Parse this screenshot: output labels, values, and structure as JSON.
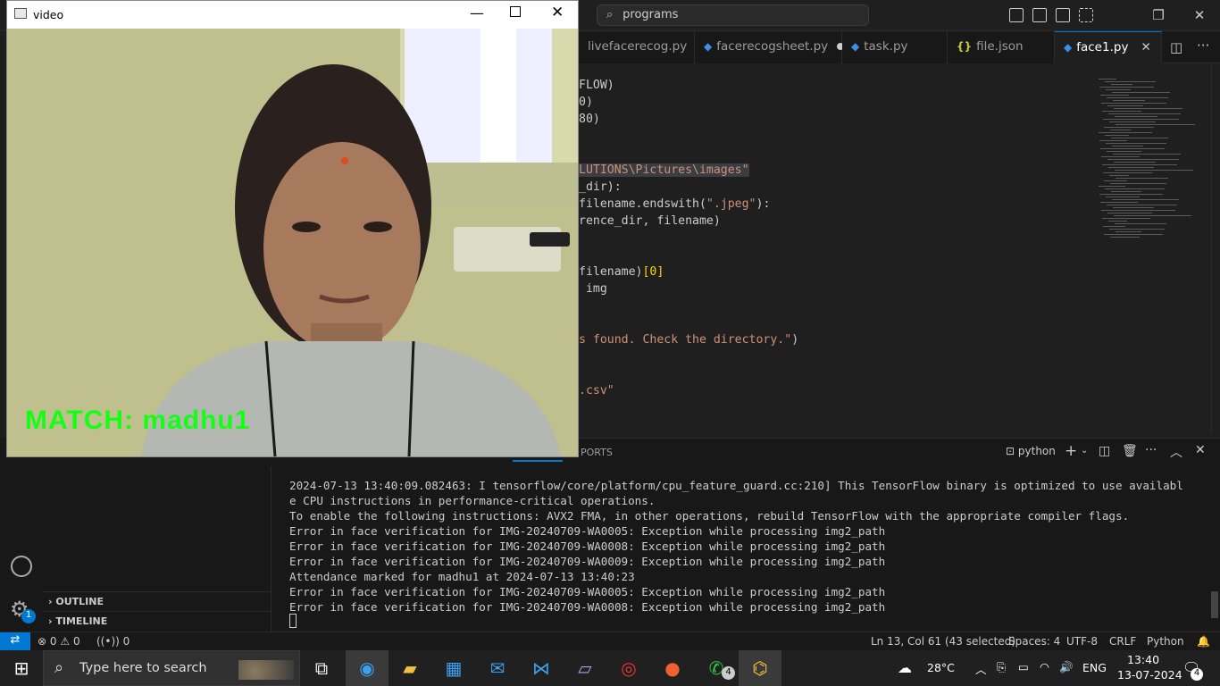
{
  "vscode": {
    "command_center": "programs",
    "tabs": [
      {
        "label": "livefacerecog.py",
        "type": "python"
      },
      {
        "label": "facerecogsheet.py",
        "type": "python",
        "modified": true
      },
      {
        "label": "task.py",
        "type": "python"
      },
      {
        "label": "file.json",
        "type": "json"
      },
      {
        "label": "face1.py",
        "type": "python",
        "active": true
      }
    ],
    "code_lines": [
      {
        "t1": "FLOW)",
        "b": ""
      },
      {
        "t1": "0)",
        "b": ""
      },
      {
        "t1": "80)",
        "b": ""
      },
      {
        "t1": "",
        "b": ""
      },
      {
        "t1": "",
        "b": ""
      },
      {
        "s": "LUTIONS\\Pictures\\images\"",
        "b": ""
      },
      {
        "t1": "_dir):",
        "b": ""
      },
      {
        "t1": "filename.endswith(",
        "s": "\".jpeg\"",
        "t2": "):"
      },
      {
        "t1": "rence_dir, filename)",
        "b": ""
      },
      {
        "t1": "",
        "b": ""
      },
      {
        "t1": "",
        "b": ""
      },
      {
        "t1": "filename)",
        "b": "[0]"
      },
      {
        "t1": " img",
        "b": ""
      },
      {
        "t1": "",
        "b": ""
      },
      {
        "t1": "",
        "b": ""
      },
      {
        "s": "s found. Check the directory.\"",
        "t2": ")"
      },
      {
        "t1": "",
        "b": ""
      },
      {
        "t1": "",
        "b": ""
      },
      {
        "s": ".csv\"",
        "b": ""
      }
    ],
    "panel": {
      "ports_tab": "PORTS",
      "terminal_name": "python"
    },
    "terminal_lines": [
      "2024-07-13 13:40:09.082463: I tensorflow/core/platform/cpu_feature_guard.cc:210] This TensorFlow binary is optimized to use availabl",
      "e CPU instructions in performance-critical operations.",
      "To enable the following instructions: AVX2 FMA, in other operations, rebuild TensorFlow with the appropriate compiler flags.",
      "Error in face verification for IMG-20240709-WA0005: Exception while processing img2_path",
      "Error in face verification for IMG-20240709-WA0008: Exception while processing img2_path",
      "Error in face verification for IMG-20240709-WA0009: Exception while processing img2_path",
      "Attendance marked for madhu1 at 2024-07-13 13:40:23",
      "Error in face verification for IMG-20240709-WA0005: Exception while processing img2_path",
      "Error in face verification for IMG-20240709-WA0008: Exception while processing img2_path"
    ],
    "sidebar": {
      "outline": "OUTLINE",
      "timeline": "TIMELINE"
    },
    "accounts_badge": "1",
    "status": {
      "errors": "0",
      "warnings": "0",
      "ports": "0",
      "position": "Ln 13, Col 61 (43 selected)",
      "spaces": "Spaces: 4",
      "encoding": "UTF-8",
      "eol": "CRLF",
      "language": "Python"
    }
  },
  "video_window": {
    "title": "video",
    "overlay_text": "MATCH: madhu1"
  },
  "taskbar": {
    "search_placeholder": "Type here to search",
    "whatsapp_badge": "4",
    "weather": "28°C",
    "language": "ENG",
    "time": "13:40",
    "date": "13-07-2024",
    "notification_count": "4"
  },
  "colors": {
    "accent": "#0078d4",
    "match_text": "#14ff14",
    "string": "#ce9178"
  }
}
